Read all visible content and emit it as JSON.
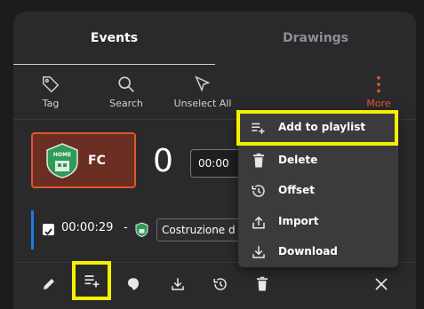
{
  "tabs": [
    {
      "label": "Events"
    },
    {
      "label": "Drawings"
    }
  ],
  "toolbar": {
    "tag": "Tag",
    "search": "Search",
    "unselect": "Unselect All",
    "more": "More"
  },
  "match": {
    "team_name": "FC",
    "badge_text": "HOME",
    "score": "0",
    "time": "00:00"
  },
  "event": {
    "time": "00:00:29",
    "dash": "-",
    "label": "Costruzione d"
  },
  "menu": {
    "items": [
      {
        "label": "Add to playlist",
        "icon": "playlist-add-icon"
      },
      {
        "label": "Delete",
        "icon": "trash-icon"
      },
      {
        "label": "Offset",
        "icon": "history-icon"
      },
      {
        "label": "Import",
        "icon": "import-icon"
      },
      {
        "label": "Download",
        "icon": "download-icon"
      }
    ]
  },
  "colors": {
    "accent": "#e0552f",
    "highlight": "#f4f100",
    "event_bar": "#1e7be0",
    "badge": "#2e9b57"
  }
}
